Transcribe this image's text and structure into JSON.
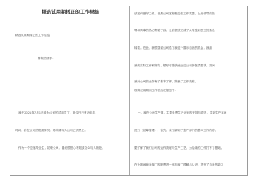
{
  "document": {
    "title": "精选试用期转正的工作总结",
    "left": {
      "subtitle": "精选试用期转正的工作总结",
      "salutation": "尊敬的领导：",
      "lines": [
        "我于2021年7月1日成为公司的试用员工，到今日已有近半年",
        "时间，我在公司的发展情况，现申请转为公司正式员工。",
        "作为一个应届毕业生，初来公司，曾经很担心不知该怎么与人相处，"
      ]
    },
    "right": {
      "lines": [
        "该如何做好工作，但是公司宽松融洽的工作氛围、上级领导的指",
        "导和同事的热心帮助了我，让我很快完成了从学生到员工的角色",
        "转变。在此，我很感谢公司给了我这个展示自我的机会，我用",
        "我的实际工作和努力，想尽可能快地适应公司的各项要求。期间",
        "我对公司的业务有了基本了解，熟悉了工作流程，",
        "现将试用期间工作总结汇报如下：",
        "一、我在公司生产部，主要负责生产计划的安排与跟进，并对生产车间",
        "进行（统筹管理）。首先，我了解到了生产部门的基本工作内容，",
        "更了解了我们公司的运作流程与生产工艺，为后续的工作打下了基础。",
        "在此期间我对部门的职责进一步加深了理解与认识，提升了自身的能力"
      ]
    }
  }
}
